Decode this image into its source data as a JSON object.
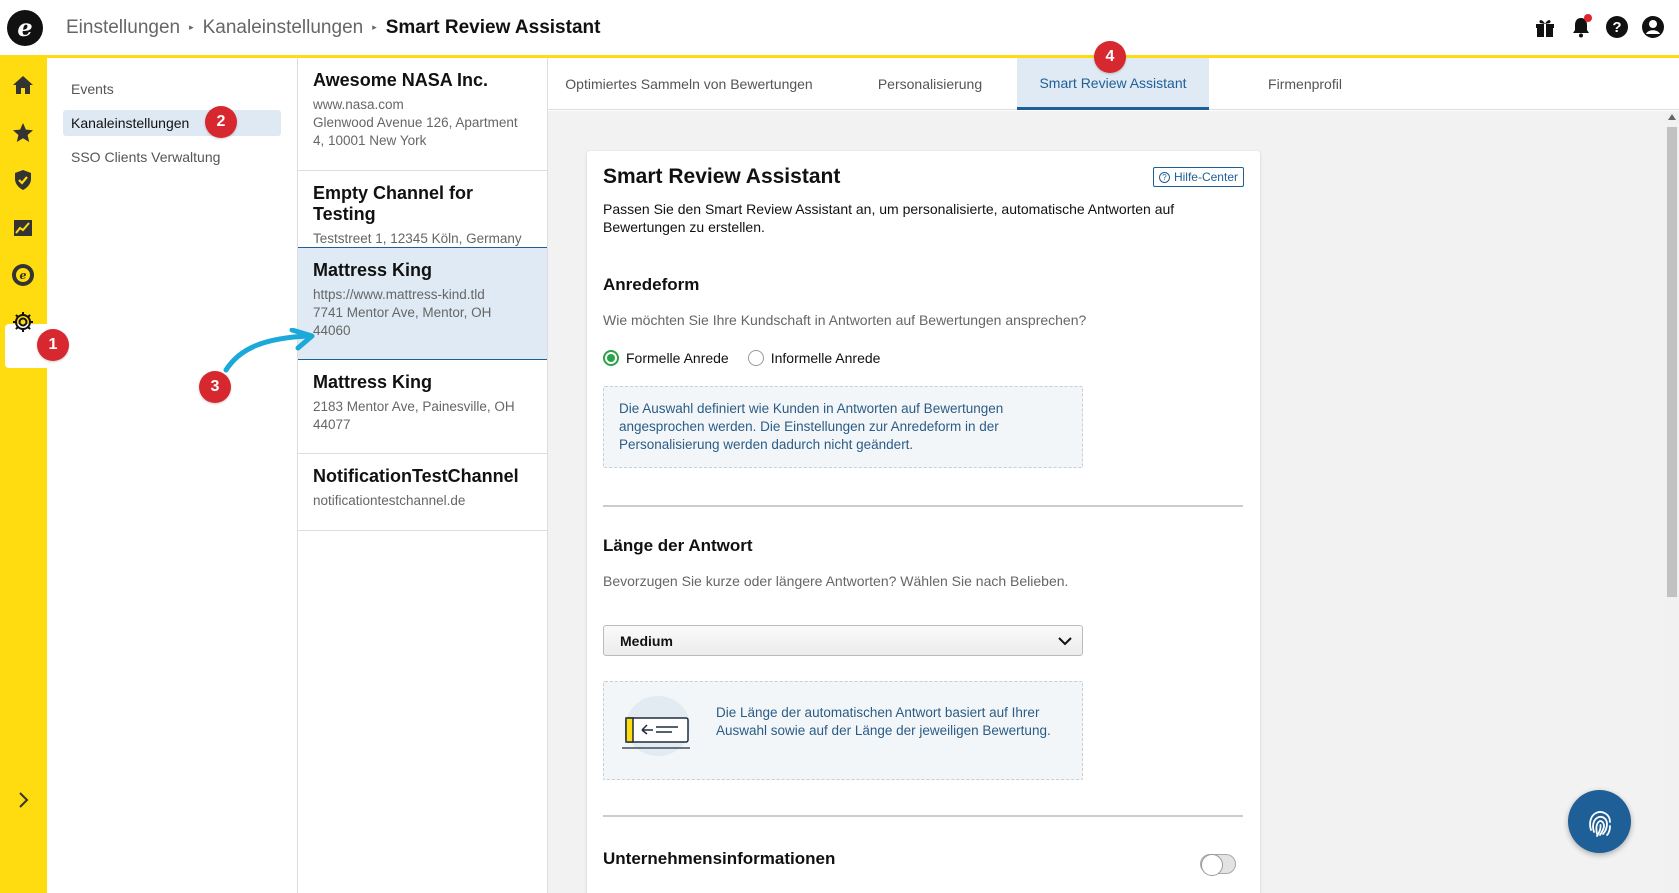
{
  "header": {
    "logo_letter": "e",
    "breadcrumb": [
      "Einstellungen",
      "Kanaleinstellungen",
      "Smart Review Assistant"
    ],
    "icons": [
      "gift-icon",
      "bell-icon",
      "help-icon",
      "account-icon"
    ]
  },
  "rail": {
    "icons": [
      "home-icon",
      "star-icon",
      "shield-check-icon",
      "chart-icon",
      "trusted-shops-icon",
      "gear-icon",
      "expand-chevron-icon"
    ]
  },
  "markers": [
    "1",
    "2",
    "3",
    "4"
  ],
  "subnav": {
    "items": [
      {
        "label": "Events"
      },
      {
        "label": "Kanaleinstellungen"
      },
      {
        "label": "SSO Clients Verwaltung"
      }
    ]
  },
  "channels": [
    {
      "name": "Awesome NASA Inc.",
      "lines": [
        "www.nasa.com",
        "Glenwood Avenue 126, Apartment",
        "4, 10001 New York"
      ]
    },
    {
      "name": "Empty Channel for Testing",
      "lines": [
        "Teststreet 1, 12345 Köln, Germany"
      ]
    },
    {
      "name": "Mattress King",
      "lines": [
        "https://www.mattress-kind.tld",
        "7741 Mentor Ave, Mentor, OH",
        "44060"
      ]
    },
    {
      "name": "Mattress King",
      "lines": [
        "2183 Mentor Ave, Painesville, OH",
        "44077"
      ]
    },
    {
      "name": "NotificationTestChannel",
      "lines": [
        "notificationtestchannel.de"
      ]
    }
  ],
  "tabs": [
    {
      "label": "Optimiertes Sammeln von Bewertungen"
    },
    {
      "label": "Personalisierung"
    },
    {
      "label": "Smart Review Assistant"
    },
    {
      "label": "Firmenprofil"
    }
  ],
  "card": {
    "title": "Smart Review Assistant",
    "help_label": "Hilfe-Center",
    "intro": "Passen Sie den Smart Review Assistant an, um personalisierte, automatische Antworten auf Bewertungen zu erstellen.",
    "salutation": {
      "title": "Anredeform",
      "question": "Wie möchten Sie Ihre Kundschaft in Antworten auf Bewertungen ansprechen?",
      "options": [
        {
          "label": "Formelle Anrede",
          "selected": true
        },
        {
          "label": "Informelle Anrede",
          "selected": false
        }
      ],
      "info": "Die Auswahl definiert wie Kunden in Antworten auf Bewertungen angesprochen werden. Die Einstellungen zur Anredeform in der Personalisierung werden dadurch nicht geändert."
    },
    "length": {
      "title": "Länge der Antwort",
      "question": "Bevorzugen Sie kurze oder längere Antworten? Wählen Sie nach Belieben.",
      "selected": "Medium",
      "info": "Die Länge der automatischen Antwort basiert auf Ihrer Auswahl sowie auf der Länge der jeweiligen Bewertung."
    },
    "company": {
      "title": "Unternehmensinformationen",
      "enabled": false
    }
  },
  "colors": {
    "brand_yellow": "#ffdc0f",
    "primary_blue": "#1f5f97",
    "marker_red": "#d7282f",
    "annotation_cyan": "#1aa9d8",
    "radio_green": "#2aa34a"
  }
}
